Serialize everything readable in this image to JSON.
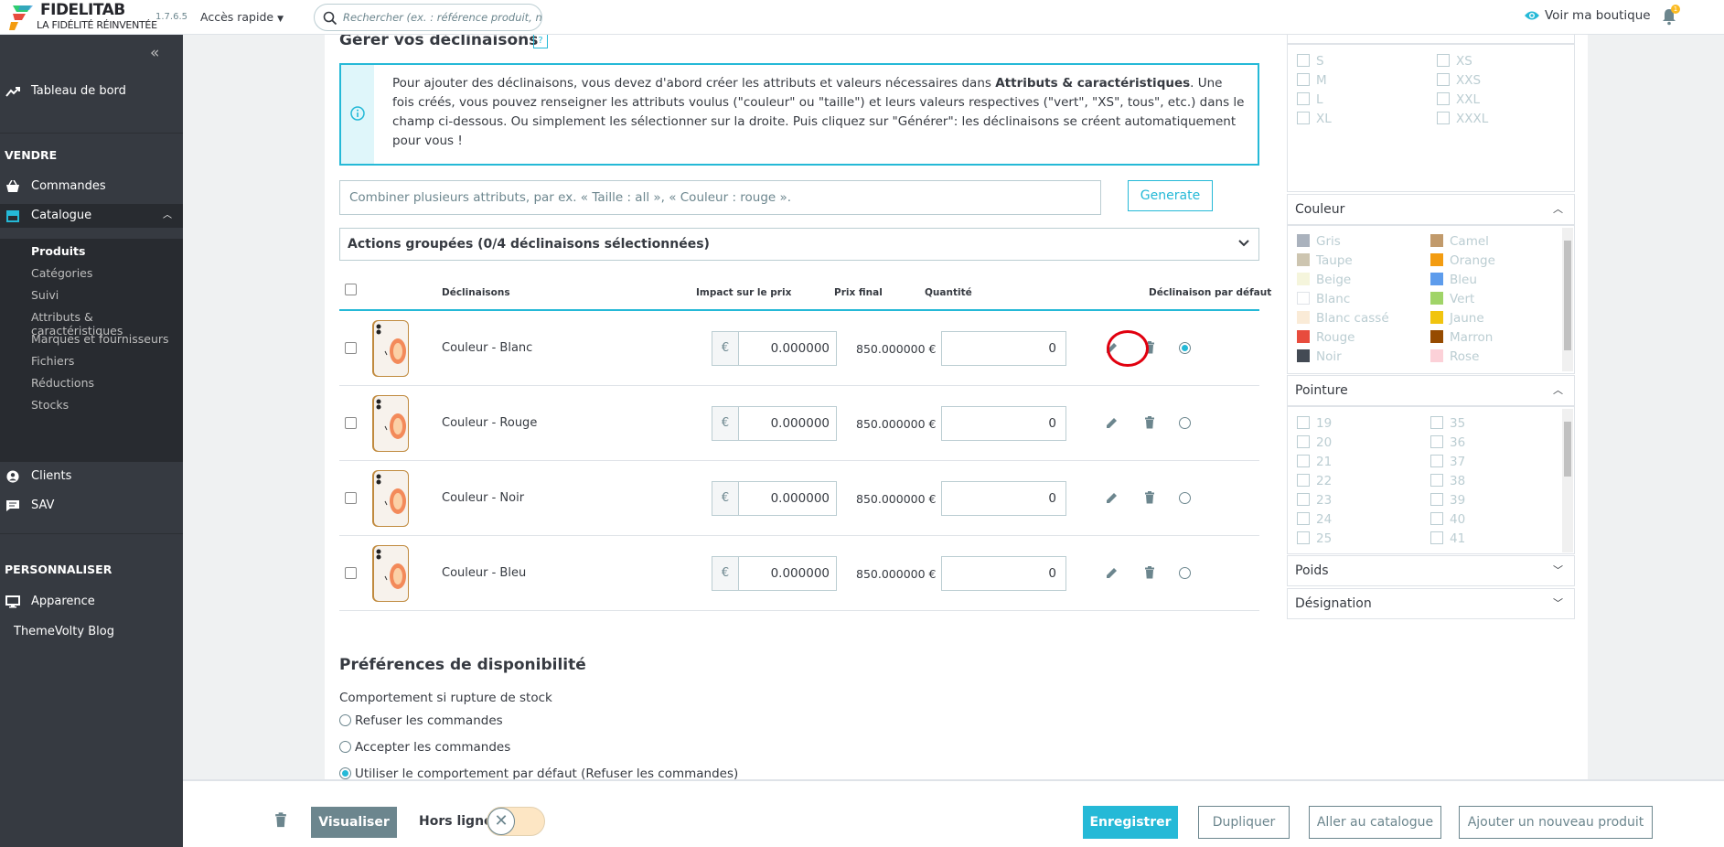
{
  "brand": {
    "name": "FIDELITAB",
    "tagline": "LA FIDÉLITÉ RÉINVENTÉE",
    "version": "1.7.6.5"
  },
  "topbar": {
    "quick_access": "Accès rapide",
    "search_placeholder": "Rechercher (ex. : référence produit, nom",
    "view_shop": "Voir ma boutique",
    "notif_count": "1"
  },
  "sidebar": {
    "dashboard": "Tableau de bord",
    "sell_section": "VENDRE",
    "orders": "Commandes",
    "catalog": "Catalogue",
    "catalog_items": [
      "Produits",
      "Catégories",
      "Suivi",
      "Attributs & caractéristiques",
      "Marques et fournisseurs",
      "Fichiers",
      "Réductions",
      "Stocks"
    ],
    "clients": "Clients",
    "sav": "SAV",
    "customize_section": "PERSONNALISER",
    "appearance": "Apparence",
    "blog": "ThemeVolty Blog"
  },
  "combos": {
    "title": "Gérer vos déclinaisons",
    "help": "?",
    "info_pre": "Pour ajouter des déclinaisons, vous devez d'abord créer les attributs et valeurs nécessaires dans ",
    "info_bold": "Attributs & caractéristiques",
    "info_post": ". Une fois créés, vous pouvez renseigner les attributs voulus (\"couleur\" ou \"taille\") et leurs valeurs respectives (\"vert\", \"XS\", tous\", etc.) dans le champ ci-dessous. Ou simplement les sélectionner sur la droite. Puis cliquez sur \"Générer\": les déclinaisons se créent automatiquement pour vous !",
    "combine_placeholder": "Combiner plusieurs attributs, par ex. « Taille : all », « Couleur : rouge ».",
    "generate": "Generate",
    "bulk_actions": "Actions groupées (0/4 déclinaisons sélectionnées)",
    "headers": {
      "name": "Déclinaisons",
      "impact": "Impact sur le prix",
      "final": "Prix final",
      "qty": "Quantité",
      "default": "Déclinaison par défaut"
    },
    "rows": [
      {
        "name": "Couleur - Blanc",
        "currency": "€",
        "impact": "0.000000",
        "final": "850.000000 €",
        "qty": "0",
        "default": true
      },
      {
        "name": "Couleur - Rouge",
        "currency": "€",
        "impact": "0.000000",
        "final": "850.000000 €",
        "qty": "0",
        "default": false
      },
      {
        "name": "Couleur - Noir",
        "currency": "€",
        "impact": "0.000000",
        "final": "850.000000 €",
        "qty": "0",
        "default": false
      },
      {
        "name": "Couleur - Bleu",
        "currency": "€",
        "impact": "0.000000",
        "final": "850.000000 €",
        "qty": "0",
        "default": false
      }
    ]
  },
  "availability": {
    "title": "Préférences de disponibilité",
    "subtitle": "Comportement si rupture de stock",
    "options": [
      "Refuser les commandes",
      "Accepter les commandes",
      "Utiliser le comportement par défaut (Refuser les commandes)"
    ],
    "selected": 2
  },
  "right_panel": {
    "sizes": [
      "S",
      "XS",
      "M",
      "XXS",
      "L",
      "XXL",
      "XL",
      "XXXL"
    ],
    "color_title": "Couleur",
    "colors": [
      {
        "name": "Gris",
        "hex": "#aab2bd"
      },
      {
        "name": "Camel",
        "hex": "#c19a6b"
      },
      {
        "name": "Taupe",
        "hex": "#cdc5b0"
      },
      {
        "name": "Orange",
        "hex": "#f39c11"
      },
      {
        "name": "Beige",
        "hex": "#f5f5dc"
      },
      {
        "name": "Bleu",
        "hex": "#5d9cec"
      },
      {
        "name": "Blanc",
        "hex": "#ffffff"
      },
      {
        "name": "Vert",
        "hex": "#a0d468"
      },
      {
        "name": "Blanc cassé",
        "hex": "#faebd7"
      },
      {
        "name": "Jaune",
        "hex": "#f1c40f"
      },
      {
        "name": "Rouge",
        "hex": "#e84c3d"
      },
      {
        "name": "Marron",
        "hex": "#964b00"
      },
      {
        "name": "Noir",
        "hex": "#434a54"
      },
      {
        "name": "Rose",
        "hex": "#fcd1d8"
      }
    ],
    "shoe_title": "Pointure",
    "shoe_sizes": [
      "19",
      "35",
      "20",
      "36",
      "21",
      "37",
      "22",
      "38",
      "23",
      "39",
      "24",
      "40",
      "25",
      "41"
    ],
    "weight_title": "Poids",
    "designation_title": "Désignation"
  },
  "footer": {
    "preview": "Visualiser",
    "offline": "Hors ligne",
    "save": "Enregistrer",
    "duplicate": "Dupliquer",
    "go_catalog": "Aller au catalogue",
    "add_product": "Ajouter un nouveau produit"
  },
  "colors": {
    "accent": "#25b9d7",
    "sidebar": "#363a41",
    "highlight": "#e1000f"
  }
}
